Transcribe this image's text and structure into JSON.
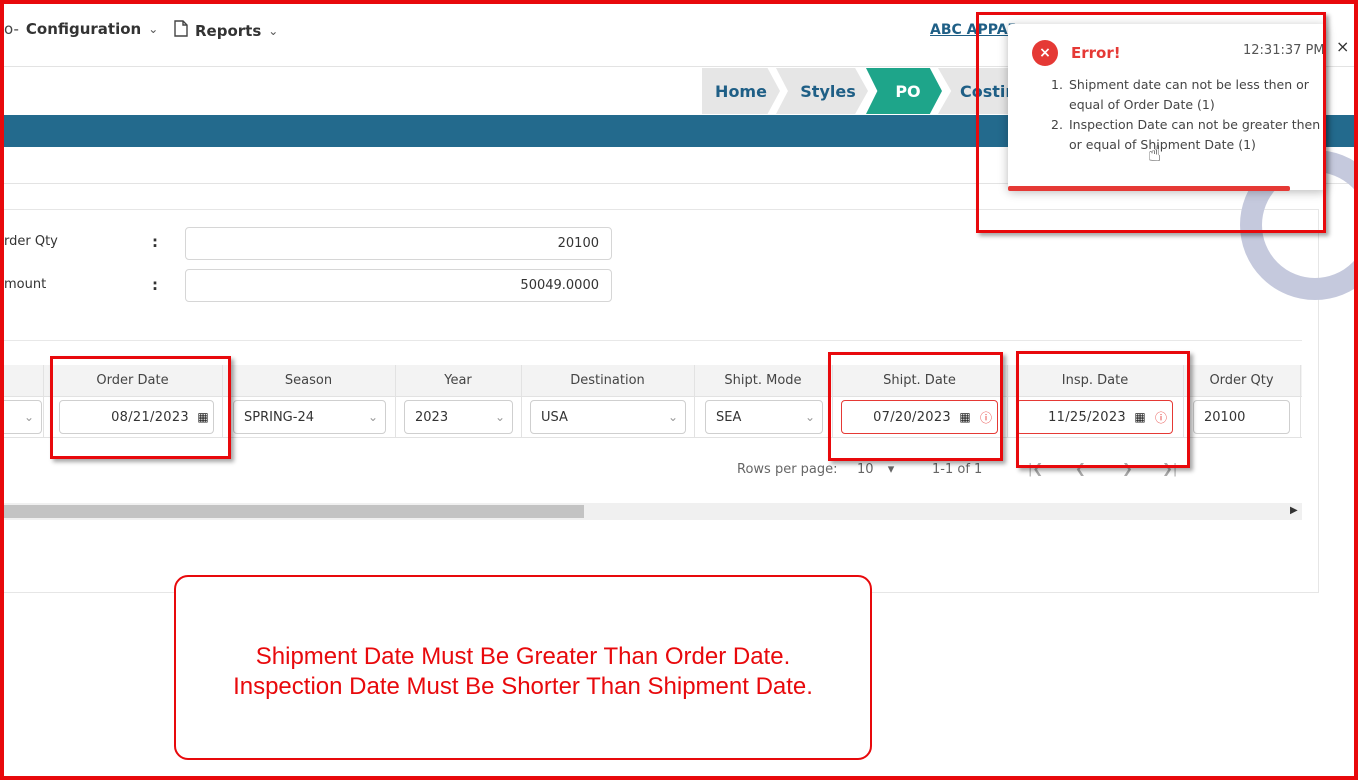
{
  "nav": {
    "configuration": "Configuration",
    "reports": "Reports",
    "company": "ABC APPAR"
  },
  "breadcrumb": [
    "Home",
    "Styles",
    "PO",
    "Costin"
  ],
  "summary": {
    "order_qty_label": "rder Qty",
    "order_qty_value": "20100",
    "amount_label": "mount",
    "amount_value": "50049.0000",
    "colon": ":"
  },
  "table": {
    "headers": [
      "Order Date",
      "Season",
      "Year",
      "Destination",
      "Shipt. Mode",
      "Shipt. Date",
      "Insp. Date",
      "Order Qty"
    ],
    "row": {
      "order_date": "08/21/2023",
      "season": "SPRING-24",
      "year": "2023",
      "destination": "USA",
      "shipt_mode": "SEA",
      "shipt_date": "07/20/2023",
      "insp_date": "11/25/2023",
      "order_qty": "20100"
    }
  },
  "pager": {
    "rows_per_page_label": "Rows per page:",
    "rows_per_page_value": "10",
    "range": "1-1 of 1"
  },
  "toast": {
    "title": "Error!",
    "time": "12:31:37 PM",
    "close": "×",
    "errors": [
      "Shipment date can not be less then or equal of Order Date (1)",
      "Inspection Date can not be greater then or equal of Shipment Date (1)"
    ]
  },
  "annotation": {
    "line1": "Shipment Date Must Be Greater Than Order Date.",
    "line2": "Inspection Date Must Be Shorter Than Shipment Date."
  },
  "colors": {
    "annotation_red": "#e8090c",
    "banner": "#236a8d",
    "breadcrumb_active": "#1ea58a",
    "error": "#e53935"
  },
  "icons": [
    "key-icon",
    "document-icon",
    "chevron-down-icon",
    "calendar-icon",
    "error-circle-icon",
    "close-icon",
    "hand-cursor-icon"
  ]
}
